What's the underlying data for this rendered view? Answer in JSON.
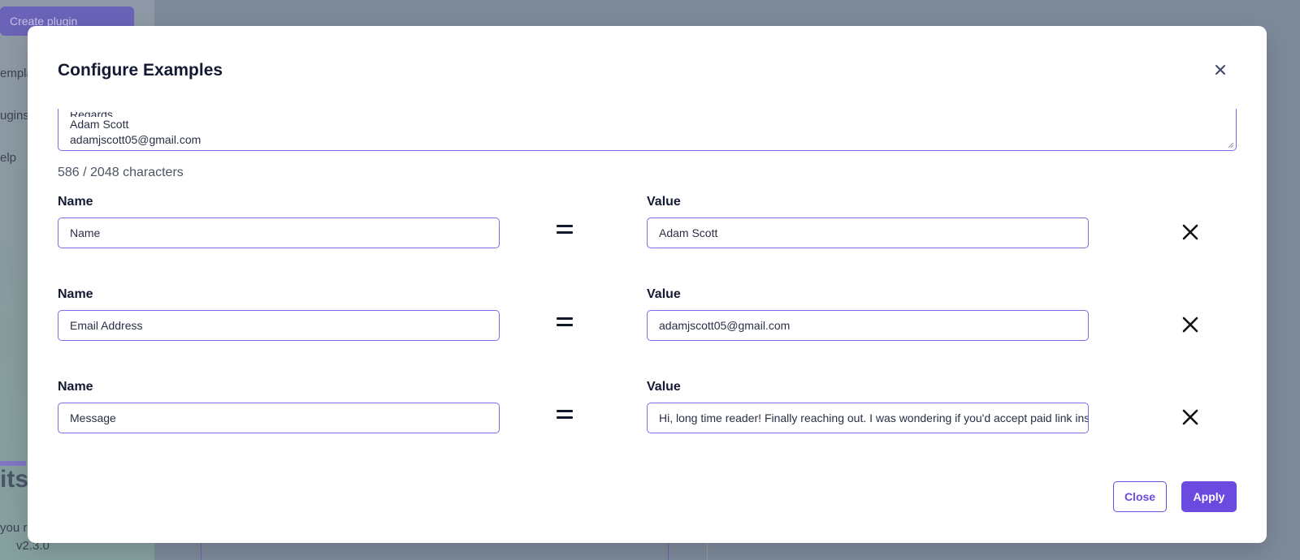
{
  "background": {
    "create_plugin_label": "Create plugin",
    "nav_items": [
      {
        "label": "empla"
      },
      {
        "label": "ugins"
      },
      {
        "label": "elp"
      }
    ],
    "logo_text": "its",
    "footer_text": "you r",
    "version": "v2.3.0"
  },
  "modal": {
    "title": "Configure Examples",
    "close_icon": "close-icon",
    "textarea": {
      "partial_line": "Regards",
      "lines": [
        "Adam Scott",
        "adamjscott05@gmail.com"
      ]
    },
    "char_count": "586 / 2048 characters",
    "fields": [
      {
        "name_label": "Name",
        "name_value": "Name",
        "value_label": "Value",
        "value_value": "Adam Scott"
      },
      {
        "name_label": "Name",
        "name_value": "Email Address",
        "value_label": "Value",
        "value_value": "adamjscott05@gmail.com"
      },
      {
        "name_label": "Name",
        "name_value": "Message",
        "value_label": "Value",
        "value_value": "Hi, long time reader! Finally reaching out. I was wondering if you'd accept paid link insertions on your blog."
      }
    ],
    "close_button": "Close",
    "apply_button": "Apply"
  },
  "colors": {
    "accent": "#6c4ae0",
    "input_border": "#7c6ee6",
    "title_text": "#141a33",
    "overlay": "#7b8794"
  }
}
